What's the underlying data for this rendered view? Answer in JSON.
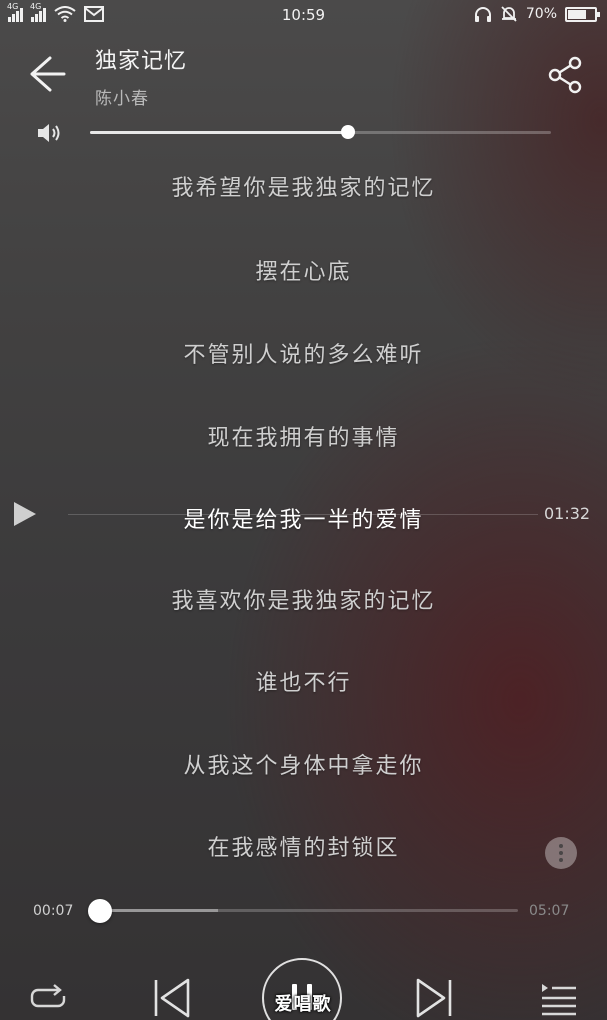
{
  "status_bar": {
    "signal1_label": "4G",
    "signal2_label": "4G",
    "time": "10:59",
    "battery_text": "70%",
    "battery_level": 0.7
  },
  "song": {
    "title": "独家记忆",
    "artist": "陈小春"
  },
  "volume": {
    "level": 0.56
  },
  "lyrics": [
    "我希望你是我独家的记忆",
    "摆在心底",
    "不管别人说的多么难听",
    "现在我拥有的事情",
    "是你是给我一半的爱情",
    "我喜欢你是我独家的记忆",
    "谁也不行",
    "从我这个身体中拿走你",
    "在我感情的封锁区"
  ],
  "current_lyric_index": 4,
  "lyric_position_time": "01:32",
  "progress": {
    "elapsed": "00:07",
    "total": "05:07",
    "played_fraction": 0.023,
    "buffered_fraction": 0.3
  },
  "watermark": "爱唱歌",
  "icons": {
    "back": "arrow-left-icon",
    "share": "share-icon",
    "volume": "speaker-icon",
    "play_line": "play-triangle-icon",
    "more": "more-vertical-icon",
    "repeat": "repeat-icon",
    "prev": "skip-previous-icon",
    "pause": "pause-icon",
    "next": "skip-next-icon",
    "playlist": "playlist-icon"
  }
}
